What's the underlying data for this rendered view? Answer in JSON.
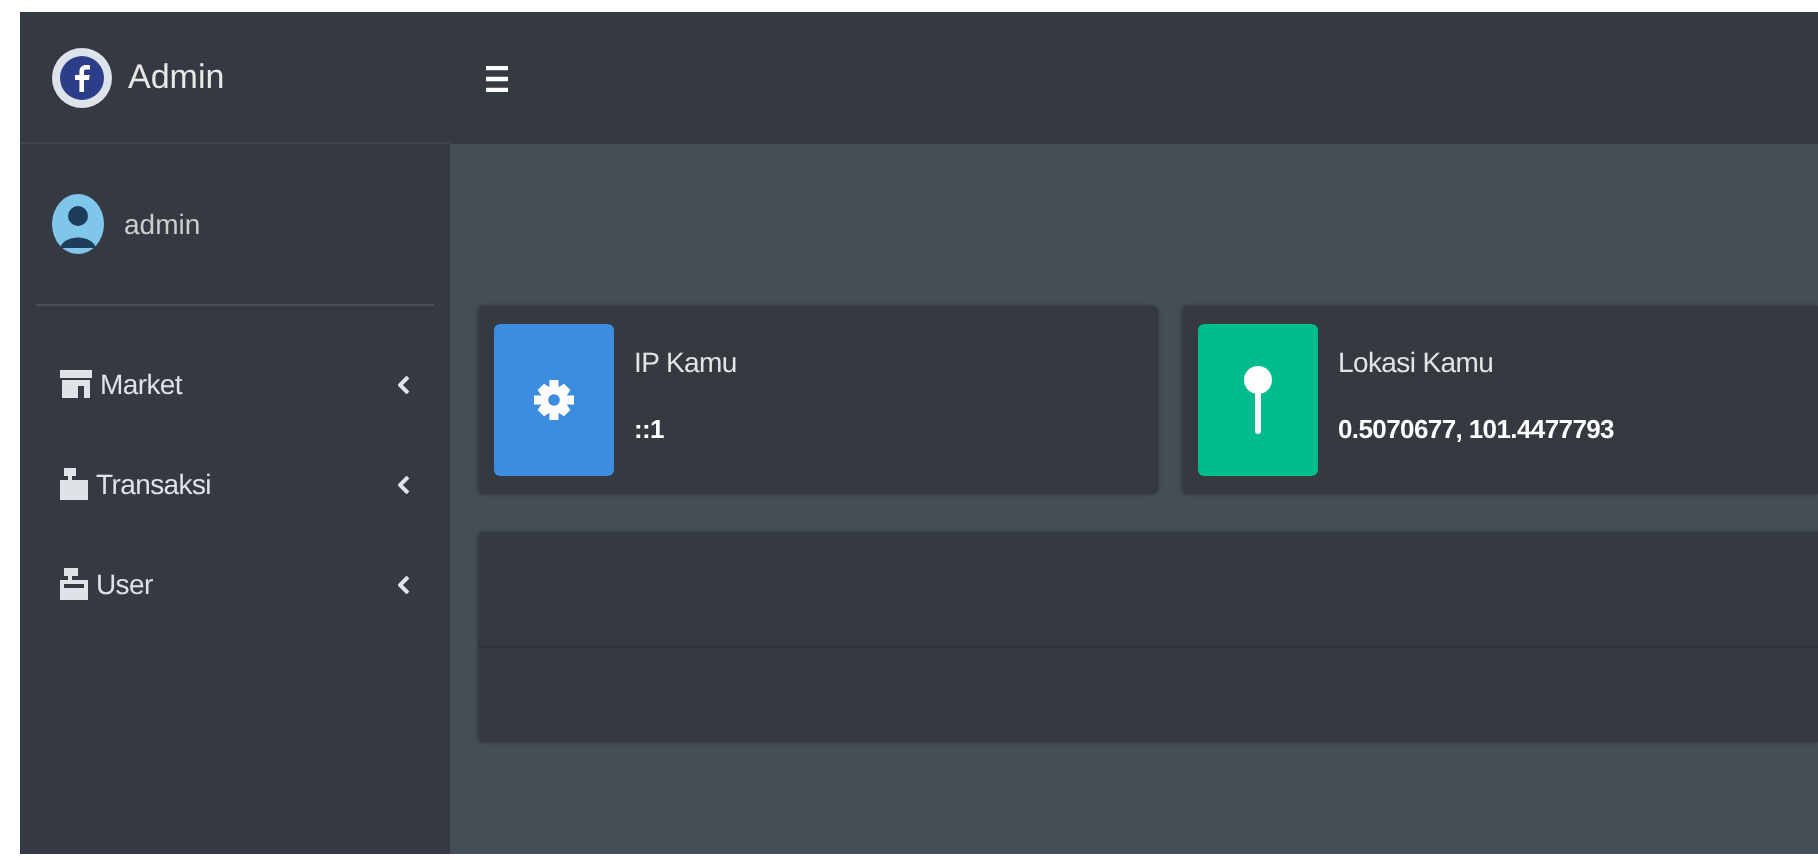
{
  "brand": {
    "title": "Admin"
  },
  "user": {
    "name": "admin"
  },
  "sidebar": {
    "items": [
      {
        "label": "Market",
        "expanded": false
      },
      {
        "label": "Transaksi",
        "expanded": false
      },
      {
        "label": "User",
        "expanded": false
      }
    ]
  },
  "info_boxes": [
    {
      "title": "IP Kamu",
      "value": "::1",
      "color": "#3c8dde"
    },
    {
      "title": "Lokasi Kamu",
      "value": "0.5070677, 101.4477793",
      "color": "#00bc8c"
    }
  ]
}
